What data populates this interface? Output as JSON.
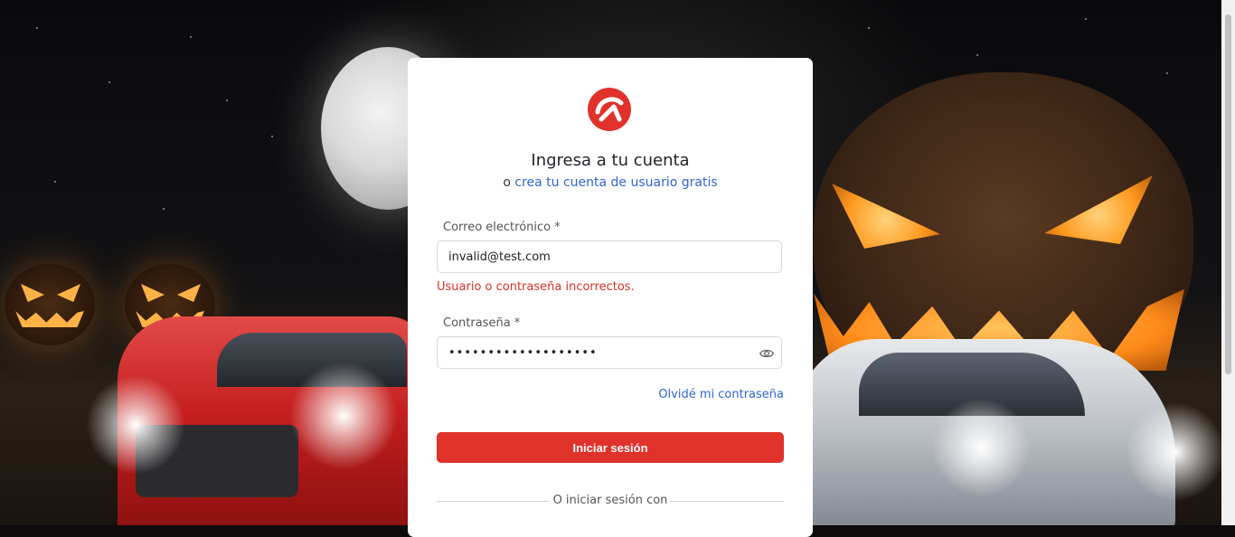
{
  "form": {
    "title": "Ingresa a tu cuenta",
    "subtitle_prefix": "o",
    "subtitle_link": "crea tu cuenta de usuario gratis",
    "email_label": "Correo electrónico *",
    "email_value": "invalid@test.com",
    "error_message": "Usuario o contraseña incorrectos.",
    "password_label": "Contraseña *",
    "password_value": "•••••••••••••••••••",
    "forgot_link": "Olvidé mi contraseña",
    "submit_label": "Iniciar sesión",
    "divider_text": "O iniciar sesión con"
  },
  "colors": {
    "brand_red": "#e0322b",
    "link_blue": "#2f66d0",
    "error_red": "#d93025"
  },
  "icons": {
    "logo": "brand-logo-icon",
    "password_toggle": "eye-icon"
  }
}
